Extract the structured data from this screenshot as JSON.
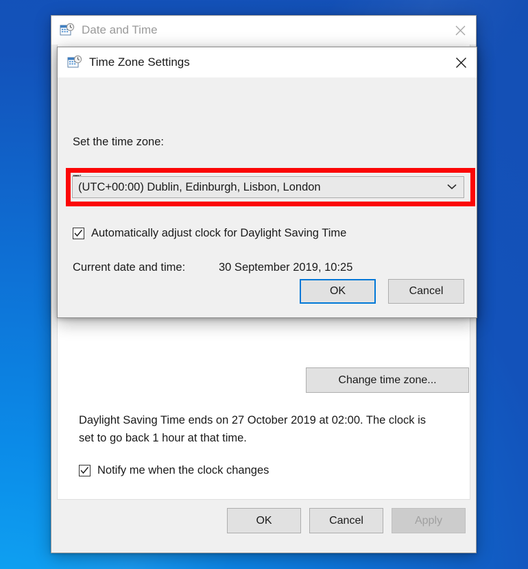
{
  "desktop": {
    "gradient_from": "#10a9f5",
    "gradient_to": "#144fb4"
  },
  "back_window": {
    "title": "Date and Time",
    "icon": "date-time-icon",
    "close_label": "✕",
    "change_time_zone_button": "Change time zone...",
    "dst_note": "Daylight Saving Time ends on 27 October 2019 at 02:00. The clock is set to go back 1 hour at that time.",
    "notify_checkbox": {
      "label": "Notify me when the clock changes",
      "checked": true
    },
    "footer_buttons": [
      {
        "label": "OK",
        "disabled": false
      },
      {
        "label": "Cancel",
        "disabled": false
      },
      {
        "label": "Apply",
        "disabled": true
      }
    ]
  },
  "tz_dialog": {
    "title": "Time Zone Settings",
    "icon": "date-time-icon",
    "close_label": "✕",
    "set_label": "Set the time zone:",
    "zone_label": "Time zone:",
    "dropdown": {
      "value": "(UTC+00:00) Dublin, Edinburgh, Lisbon, London",
      "chevron": "chevron-down-icon"
    },
    "highlight_color": "#fb0606",
    "dst_checkbox": {
      "label": "Automatically adjust clock for Daylight Saving Time",
      "checked": true
    },
    "current_label": "Current date and time:",
    "current_value": "30 September 2019, 10:25",
    "buttons": [
      {
        "label": "OK",
        "focused": true
      },
      {
        "label": "Cancel",
        "focused": false
      }
    ],
    "focus_color": "#0078d7"
  }
}
